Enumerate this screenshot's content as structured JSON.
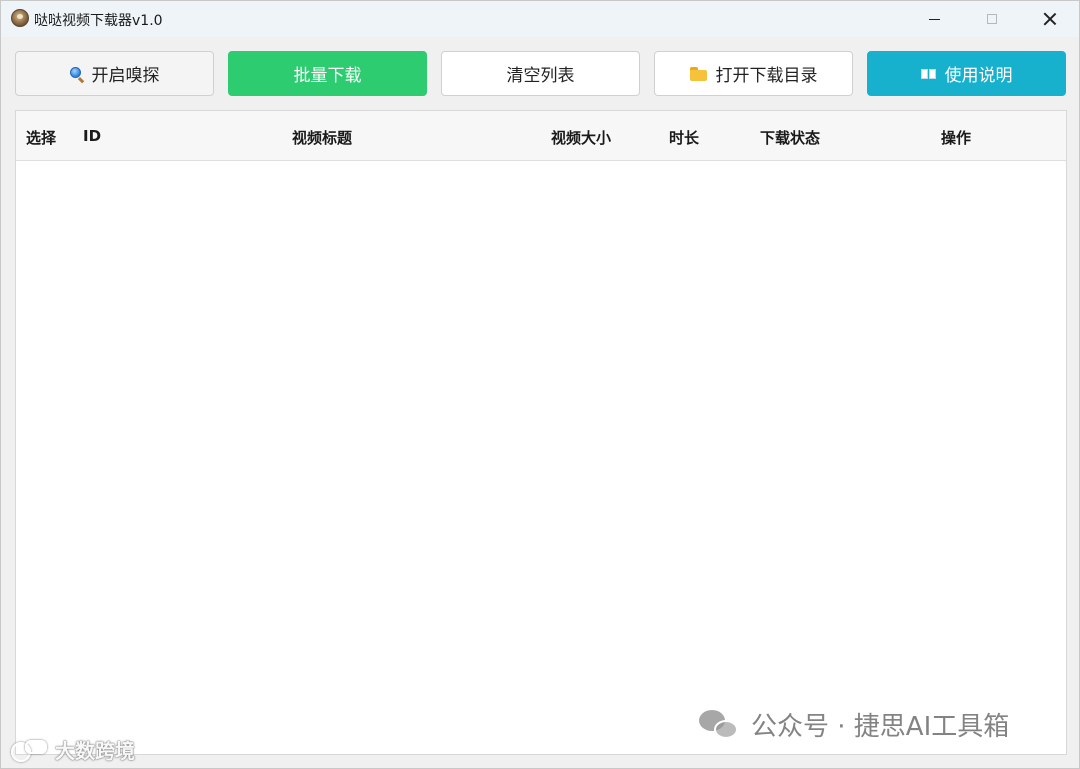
{
  "window": {
    "title": "哒哒视频下载器v1.0"
  },
  "toolbar": {
    "sniff_label": "开启嗅探",
    "batch_download_label": "批量下载",
    "clear_list_label": "清空列表",
    "open_folder_label": "打开下载目录",
    "help_label": "使用说明",
    "colors": {
      "batch_download": "#2ecc71",
      "help": "#17b1ce"
    },
    "icons": {
      "sniff": "search-icon",
      "open_folder": "folder-icon",
      "help": "book-icon"
    }
  },
  "table": {
    "columns": [
      "选择",
      "ID",
      "视频标题",
      "视频大小",
      "时长",
      "下载状态",
      "操作"
    ],
    "rows": []
  },
  "watermarks": {
    "right": "公众号 · 捷思AI工具箱",
    "left": "大数跨境"
  }
}
